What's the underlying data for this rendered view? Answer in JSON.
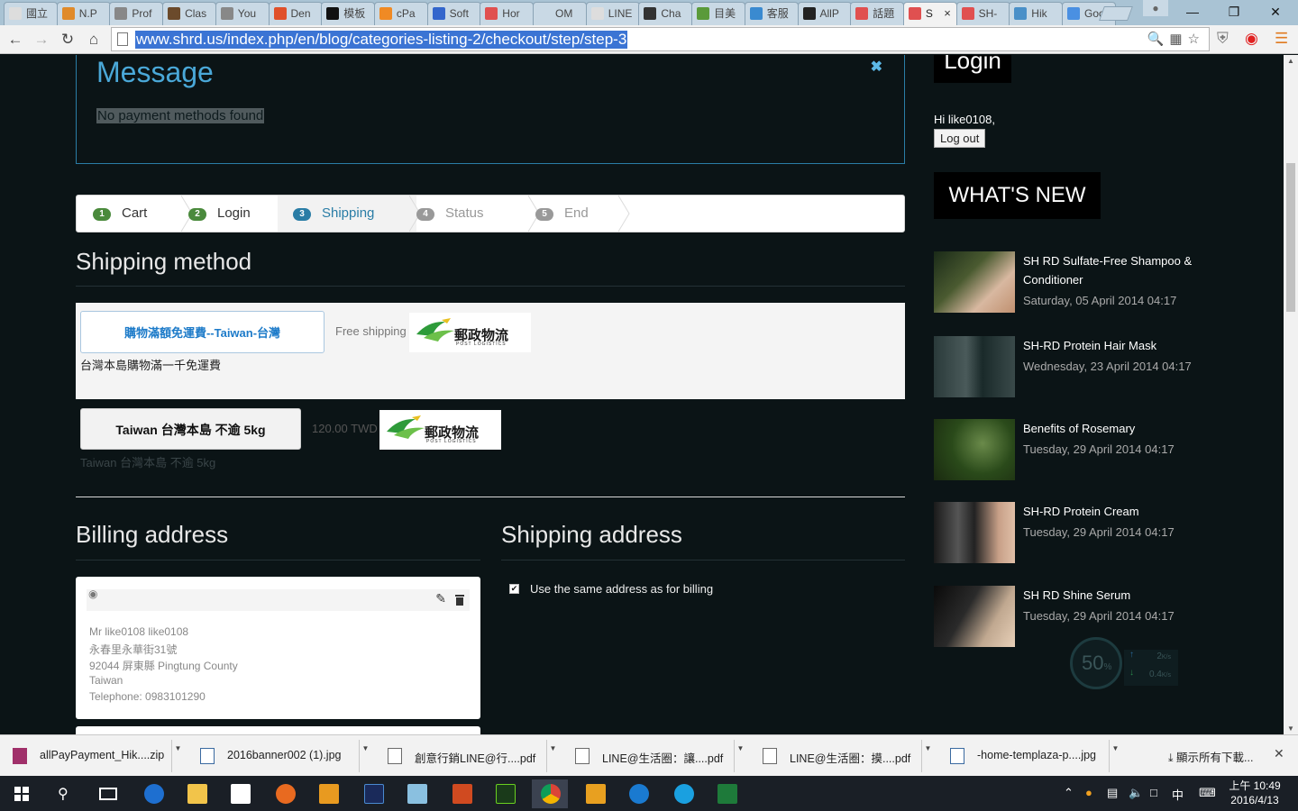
{
  "browser": {
    "tabs": [
      {
        "label": "國立",
        "color": "#ddd"
      },
      {
        "label": "N.P",
        "color": "#e08a2a"
      },
      {
        "label": "Prof",
        "color": "#888"
      },
      {
        "label": "Clas",
        "color": "#6b4a2b"
      },
      {
        "label": "You",
        "color": "#888"
      },
      {
        "label": "Den",
        "color": "#e0502a"
      },
      {
        "label": "模板",
        "color": "#111"
      },
      {
        "label": "cPa",
        "color": "#f08a24"
      },
      {
        "label": "Soft",
        "color": "#3366cc"
      },
      {
        "label": "Hor",
        "color": "#e05050"
      },
      {
        "label": "OM",
        "color": "#c9d9e5"
      },
      {
        "label": "LINE",
        "color": "#ddd"
      },
      {
        "label": "Cha",
        "color": "#333"
      },
      {
        "label": "目美",
        "color": "#5a9a3a"
      },
      {
        "label": "客服",
        "color": "#3a8ad0"
      },
      {
        "label": "AllP",
        "color": "#222"
      },
      {
        "label": "話題",
        "color": "#e05050"
      },
      {
        "label": "S",
        "color": "#e05050"
      },
      {
        "label": "SH-",
        "color": "#e05050"
      },
      {
        "label": "Hik",
        "color": "#4a90c8"
      },
      {
        "label": "Goc",
        "color": "#4a90e2"
      }
    ],
    "active_tab_index": 17,
    "url": "www.shrd.us/index.php/en/blog/categories-listing-2/checkout/step/step-3"
  },
  "message": {
    "title": "Message",
    "text": "No payment methods found",
    "close_glyph": "✖"
  },
  "steps": [
    {
      "num": "1",
      "label": "Cart",
      "state": "done",
      "color": "#4a8a3c"
    },
    {
      "num": "2",
      "label": "Login",
      "state": "done",
      "color": "#4a8a3c"
    },
    {
      "num": "3",
      "label": "Shipping",
      "state": "active",
      "color": "#2a7da6"
    },
    {
      "num": "4",
      "label": "Status",
      "state": "todo",
      "color": "#999999"
    },
    {
      "num": "5",
      "label": "End",
      "state": "todo",
      "color": "#999999"
    }
  ],
  "shipping_method": {
    "heading": "Shipping method",
    "options": [
      {
        "button": "購物滿額免運費--Taiwan-台灣",
        "price": "Free shipping",
        "desc": "台灣本島購物滿一千免運費",
        "logo_text": "郵政物流",
        "logo_sub": "POST LOGISTICS"
      },
      {
        "button": "Taiwan 台灣本島 不逾 5kg",
        "price": "120.00 TWD",
        "desc": "Taiwan 台灣本島 不逾 5kg",
        "logo_text": "郵政物流",
        "logo_sub": "POST LOGISTICS"
      }
    ]
  },
  "billing": {
    "heading": "Billing address",
    "lines": [
      "Mr like0108 like0108",
      "永春里永華街31號",
      "92044 屏東縣 Pingtung County",
      "Taiwan",
      "Telephone: 0983101290"
    ]
  },
  "shipping_address": {
    "heading": "Shipping address",
    "same_as_billing_label": "Use the same address as for billing",
    "same_as_billing_checked": true
  },
  "sidebar": {
    "login_heading": "Login",
    "greeting": "Hi like0108,",
    "logout": "Log out",
    "whats_new": "WHAT'S NEW",
    "news": [
      {
        "title": "SH RD Sulfate-Free Shampoo & Conditioner",
        "date": "Saturday, 05 April 2014 04:17"
      },
      {
        "title": "SH-RD Protein Hair Mask",
        "date": "Wednesday, 23 April 2014 04:17"
      },
      {
        "title": "Benefits of Rosemary",
        "date": "Tuesday, 29 April 2014 04:17"
      },
      {
        "title": "SH-RD Protein Cream",
        "date": "Tuesday, 29 April 2014 04:17"
      },
      {
        "title": "SH RD Shine Serum",
        "date": "Tuesday, 29 April 2014 04:17"
      }
    ]
  },
  "speed_widget": {
    "percent": "50",
    "unit": "%",
    "up": "2",
    "down": "0.4",
    "rate_unit": "K/s"
  },
  "downloads": {
    "items": [
      "allPayPayment_Hik....zip",
      "2016banner002 (1).jpg",
      "創意行銷LINE@行....pdf",
      "LINE@生活圈：讓....pdf",
      "LINE@生活圈：摸....pdf",
      "-home-templaza-p....jpg"
    ],
    "show_all": "顯示所有下載..."
  },
  "taskbar": {
    "time": "上午 10:49",
    "date": "2016/4/13",
    "ime": "中"
  }
}
